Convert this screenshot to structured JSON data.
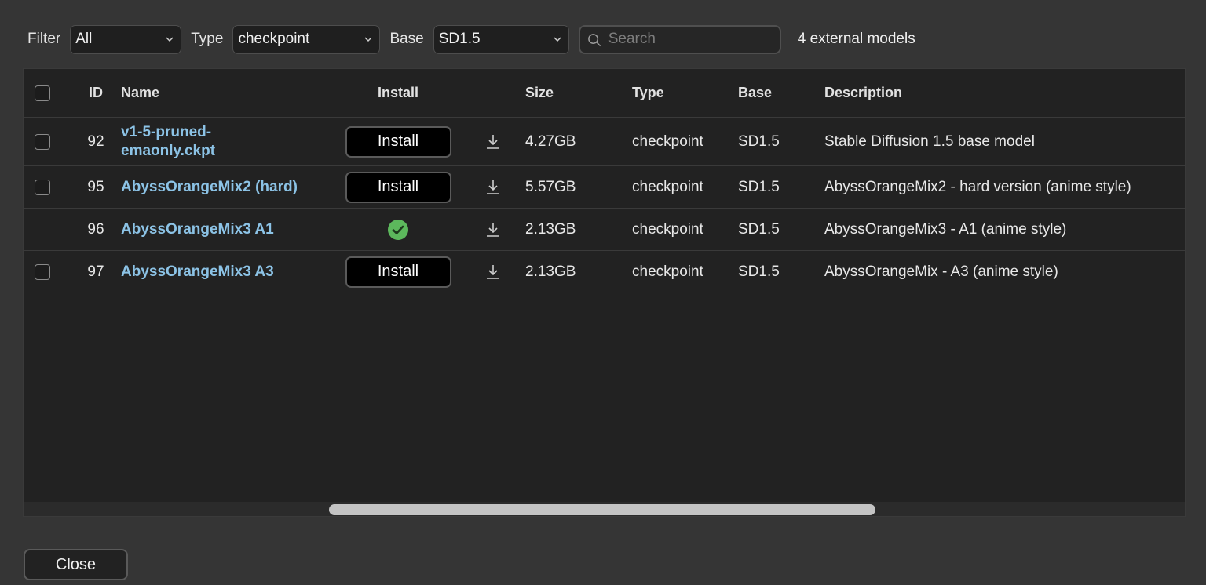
{
  "toolbar": {
    "filter_label": "Filter",
    "filter_value": "All",
    "type_label": "Type",
    "type_value": "checkpoint",
    "base_label": "Base",
    "base_value": "SD1.5",
    "search_placeholder": "Search",
    "count_text": "4 external models"
  },
  "table": {
    "headers": {
      "id": "ID",
      "name": "Name",
      "install": "Install",
      "size": "Size",
      "type": "Type",
      "base": "Base",
      "description": "Description"
    },
    "rows": [
      {
        "id": "92",
        "name": "v1-5-pruned-emaonly.ckpt",
        "install": "Install",
        "installed": false,
        "size": "4.27GB",
        "type": "checkpoint",
        "base": "SD1.5",
        "description": "Stable Diffusion 1.5 base model"
      },
      {
        "id": "95",
        "name": "AbyssOrangeMix2 (hard)",
        "install": "Install",
        "installed": false,
        "size": "5.57GB",
        "type": "checkpoint",
        "base": "SD1.5",
        "description": "AbyssOrangeMix2 - hard version (anime style)"
      },
      {
        "id": "96",
        "name": "AbyssOrangeMix3 A1",
        "install": "",
        "installed": true,
        "size": "2.13GB",
        "type": "checkpoint",
        "base": "SD1.5",
        "description": "AbyssOrangeMix3 - A1 (anime style)"
      },
      {
        "id": "97",
        "name": "AbyssOrangeMix3 A3",
        "install": "Install",
        "installed": false,
        "size": "2.13GB",
        "type": "checkpoint",
        "base": "SD1.5",
        "description": "AbyssOrangeMix - A3 (anime style)"
      }
    ]
  },
  "footer": {
    "close_label": "Close"
  },
  "colors": {
    "link": "#8cc3e6",
    "installed_check": "#5cb85c",
    "background": "#353535",
    "table_background": "#222222"
  },
  "icons": {
    "select_chevron": "chevron-down-icon",
    "search": "search-icon",
    "download": "download-icon",
    "installed": "check-circle-icon"
  }
}
